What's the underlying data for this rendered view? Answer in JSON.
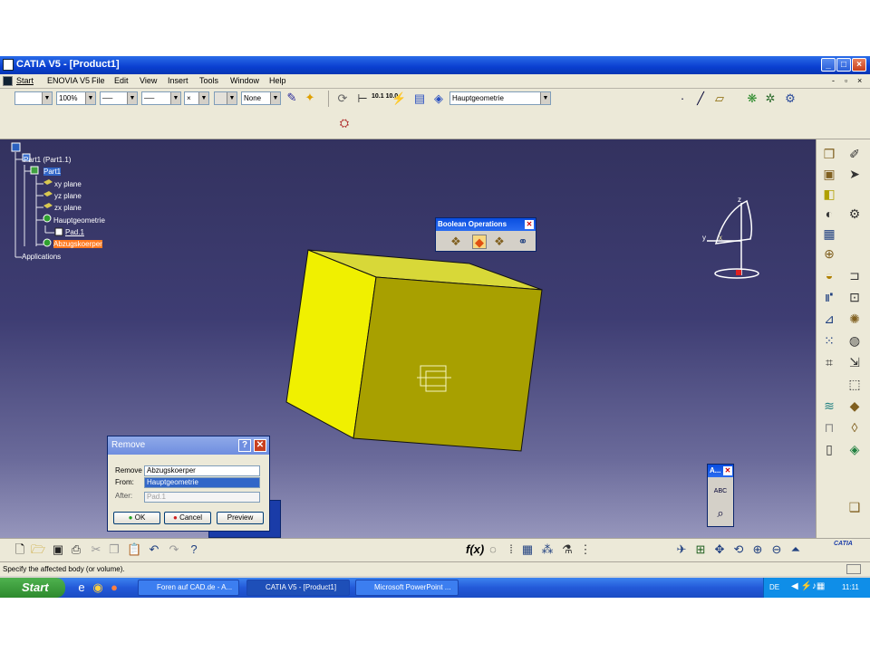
{
  "window": {
    "title": "CATIA V5 - [Product1]"
  },
  "menu": {
    "items": [
      "Start",
      "ENOVIA V5",
      "File",
      "Edit",
      "View",
      "Insert",
      "Tools",
      "Window",
      "Help"
    ]
  },
  "toolbar": {
    "zoom": "100%",
    "layer": "None",
    "body_select": "Hauptgeometrie",
    "coords_label": "10.1 10.0"
  },
  "tree": {
    "root": "Part1 (Part1.1)",
    "part": "Part1",
    "planes": [
      "xy plane",
      "yz plane",
      "zx plane"
    ],
    "body": "Hauptgeometrie",
    "pad": "Pad.1",
    "subtract_body": "Abzugskoerper",
    "applications": "Applications"
  },
  "boolean_panel": {
    "title": "Boolean Operations"
  },
  "small_panel": {
    "title": "A..."
  },
  "dialog": {
    "title": "Remove",
    "help": "?",
    "remove_label": "Remove",
    "remove_value": "Abzugskoerper",
    "from_label": "From:",
    "from_value": "Hauptgeometrie",
    "after_label": "After:",
    "after_value": "Pad.1",
    "ok": "OK",
    "cancel": "Cancel",
    "preview": "Preview"
  },
  "compass": {
    "x": "x",
    "y": "y",
    "z": "z"
  },
  "status": {
    "text": "Specify the affected body (or volume)."
  },
  "taskbar": {
    "start": "Start",
    "tasks": [
      "Foren auf CAD.de - A...",
      "CATIA V5 - [Product1]",
      "Microsoft PowerPoint ..."
    ],
    "lang": "DE",
    "time": "11:11"
  },
  "catia_logo": "CATIA",
  "colors": {
    "titlebar": "#0a3fd0",
    "viewport_top": "#33325f",
    "part_face": "#c8c800",
    "highlight_orange": "#ff7a20"
  }
}
